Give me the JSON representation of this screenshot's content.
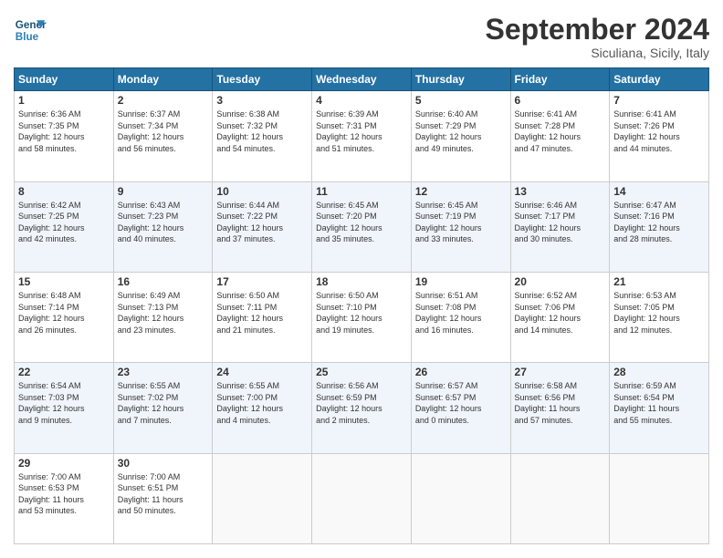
{
  "header": {
    "logo_line1": "General",
    "logo_line2": "Blue",
    "month_title": "September 2024",
    "location": "Siculiana, Sicily, Italy"
  },
  "days_of_week": [
    "Sunday",
    "Monday",
    "Tuesday",
    "Wednesday",
    "Thursday",
    "Friday",
    "Saturday"
  ],
  "weeks": [
    [
      {
        "day": "1",
        "text": "Sunrise: 6:36 AM\nSunset: 7:35 PM\nDaylight: 12 hours\nand 58 minutes."
      },
      {
        "day": "2",
        "text": "Sunrise: 6:37 AM\nSunset: 7:34 PM\nDaylight: 12 hours\nand 56 minutes."
      },
      {
        "day": "3",
        "text": "Sunrise: 6:38 AM\nSunset: 7:32 PM\nDaylight: 12 hours\nand 54 minutes."
      },
      {
        "day": "4",
        "text": "Sunrise: 6:39 AM\nSunset: 7:31 PM\nDaylight: 12 hours\nand 51 minutes."
      },
      {
        "day": "5",
        "text": "Sunrise: 6:40 AM\nSunset: 7:29 PM\nDaylight: 12 hours\nand 49 minutes."
      },
      {
        "day": "6",
        "text": "Sunrise: 6:41 AM\nSunset: 7:28 PM\nDaylight: 12 hours\nand 47 minutes."
      },
      {
        "day": "7",
        "text": "Sunrise: 6:41 AM\nSunset: 7:26 PM\nDaylight: 12 hours\nand 44 minutes."
      }
    ],
    [
      {
        "day": "8",
        "text": "Sunrise: 6:42 AM\nSunset: 7:25 PM\nDaylight: 12 hours\nand 42 minutes."
      },
      {
        "day": "9",
        "text": "Sunrise: 6:43 AM\nSunset: 7:23 PM\nDaylight: 12 hours\nand 40 minutes."
      },
      {
        "day": "10",
        "text": "Sunrise: 6:44 AM\nSunset: 7:22 PM\nDaylight: 12 hours\nand 37 minutes."
      },
      {
        "day": "11",
        "text": "Sunrise: 6:45 AM\nSunset: 7:20 PM\nDaylight: 12 hours\nand 35 minutes."
      },
      {
        "day": "12",
        "text": "Sunrise: 6:45 AM\nSunset: 7:19 PM\nDaylight: 12 hours\nand 33 minutes."
      },
      {
        "day": "13",
        "text": "Sunrise: 6:46 AM\nSunset: 7:17 PM\nDaylight: 12 hours\nand 30 minutes."
      },
      {
        "day": "14",
        "text": "Sunrise: 6:47 AM\nSunset: 7:16 PM\nDaylight: 12 hours\nand 28 minutes."
      }
    ],
    [
      {
        "day": "15",
        "text": "Sunrise: 6:48 AM\nSunset: 7:14 PM\nDaylight: 12 hours\nand 26 minutes."
      },
      {
        "day": "16",
        "text": "Sunrise: 6:49 AM\nSunset: 7:13 PM\nDaylight: 12 hours\nand 23 minutes."
      },
      {
        "day": "17",
        "text": "Sunrise: 6:50 AM\nSunset: 7:11 PM\nDaylight: 12 hours\nand 21 minutes."
      },
      {
        "day": "18",
        "text": "Sunrise: 6:50 AM\nSunset: 7:10 PM\nDaylight: 12 hours\nand 19 minutes."
      },
      {
        "day": "19",
        "text": "Sunrise: 6:51 AM\nSunset: 7:08 PM\nDaylight: 12 hours\nand 16 minutes."
      },
      {
        "day": "20",
        "text": "Sunrise: 6:52 AM\nSunset: 7:06 PM\nDaylight: 12 hours\nand 14 minutes."
      },
      {
        "day": "21",
        "text": "Sunrise: 6:53 AM\nSunset: 7:05 PM\nDaylight: 12 hours\nand 12 minutes."
      }
    ],
    [
      {
        "day": "22",
        "text": "Sunrise: 6:54 AM\nSunset: 7:03 PM\nDaylight: 12 hours\nand 9 minutes."
      },
      {
        "day": "23",
        "text": "Sunrise: 6:55 AM\nSunset: 7:02 PM\nDaylight: 12 hours\nand 7 minutes."
      },
      {
        "day": "24",
        "text": "Sunrise: 6:55 AM\nSunset: 7:00 PM\nDaylight: 12 hours\nand 4 minutes."
      },
      {
        "day": "25",
        "text": "Sunrise: 6:56 AM\nSunset: 6:59 PM\nDaylight: 12 hours\nand 2 minutes."
      },
      {
        "day": "26",
        "text": "Sunrise: 6:57 AM\nSunset: 6:57 PM\nDaylight: 12 hours\nand 0 minutes."
      },
      {
        "day": "27",
        "text": "Sunrise: 6:58 AM\nSunset: 6:56 PM\nDaylight: 11 hours\nand 57 minutes."
      },
      {
        "day": "28",
        "text": "Sunrise: 6:59 AM\nSunset: 6:54 PM\nDaylight: 11 hours\nand 55 minutes."
      }
    ],
    [
      {
        "day": "29",
        "text": "Sunrise: 7:00 AM\nSunset: 6:53 PM\nDaylight: 11 hours\nand 53 minutes."
      },
      {
        "day": "30",
        "text": "Sunrise: 7:00 AM\nSunset: 6:51 PM\nDaylight: 11 hours\nand 50 minutes."
      },
      {
        "day": "",
        "text": ""
      },
      {
        "day": "",
        "text": ""
      },
      {
        "day": "",
        "text": ""
      },
      {
        "day": "",
        "text": ""
      },
      {
        "day": "",
        "text": ""
      }
    ]
  ]
}
